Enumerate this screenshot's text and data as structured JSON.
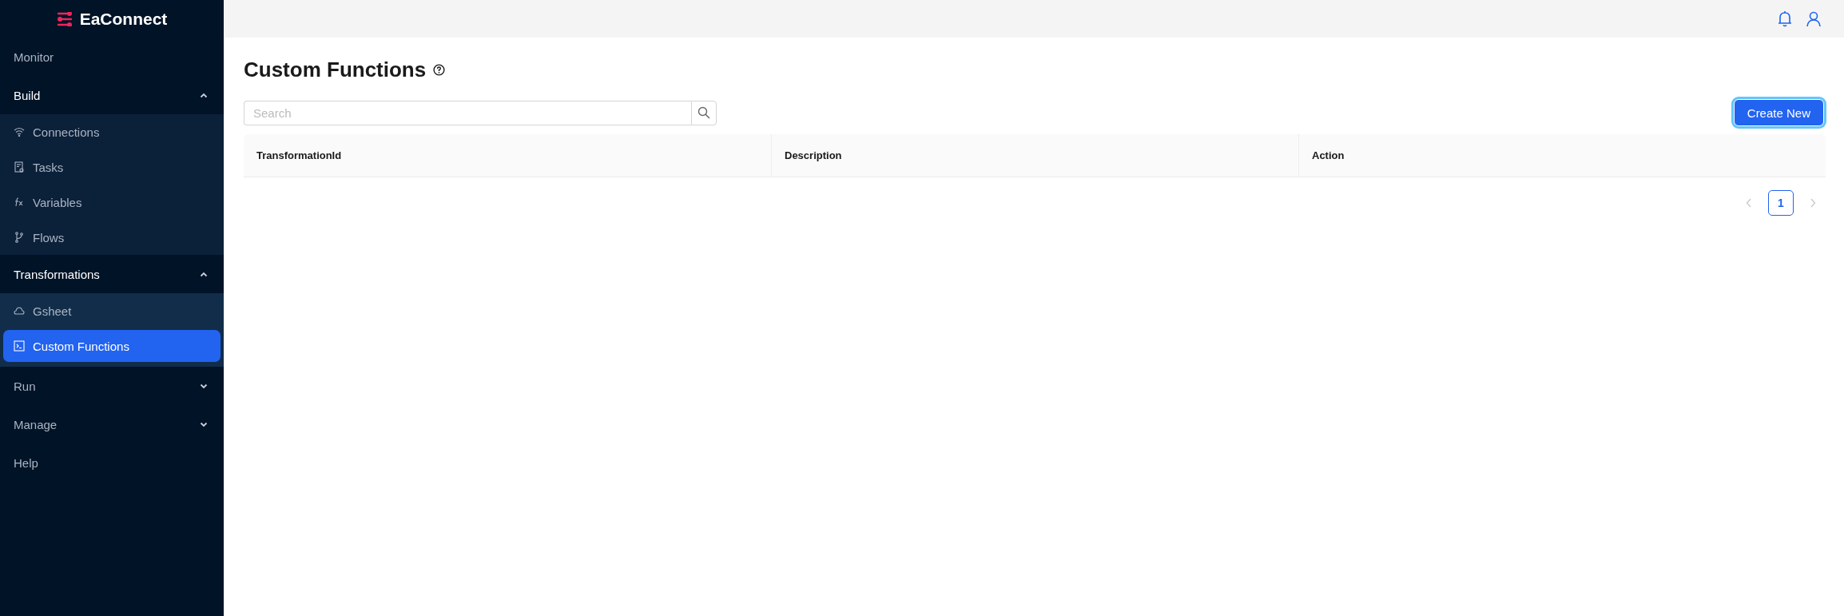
{
  "sidebar": {
    "logo": "EaConnect",
    "items": [
      {
        "kind": "link",
        "label": "Monitor"
      },
      {
        "kind": "group",
        "label": "Build",
        "expanded": true,
        "children": [
          {
            "label": "Connections",
            "selected": false
          },
          {
            "label": "Tasks",
            "selected": false
          },
          {
            "label": "Variables",
            "selected": false
          },
          {
            "label": "Flows",
            "selected": false
          }
        ]
      },
      {
        "kind": "group",
        "label": "Transformations",
        "expanded": true,
        "children": [
          {
            "label": "Gsheet",
            "selected": false
          },
          {
            "label": "Custom Functions",
            "selected": true
          }
        ]
      },
      {
        "kind": "group",
        "label": "Run",
        "expanded": false
      },
      {
        "kind": "group",
        "label": "Manage",
        "expanded": false
      },
      {
        "kind": "link",
        "label": "Help"
      }
    ]
  },
  "page": {
    "title": "Custom Functions",
    "search": {
      "placeholder": "Search"
    },
    "create_button": "Create New"
  },
  "table": {
    "columns": [
      "TransformationId",
      "Description",
      "Action"
    ]
  },
  "pagination": {
    "prev_disabled": true,
    "next_disabled": true,
    "pages": [
      {
        "label": "1",
        "selected": true
      }
    ]
  }
}
